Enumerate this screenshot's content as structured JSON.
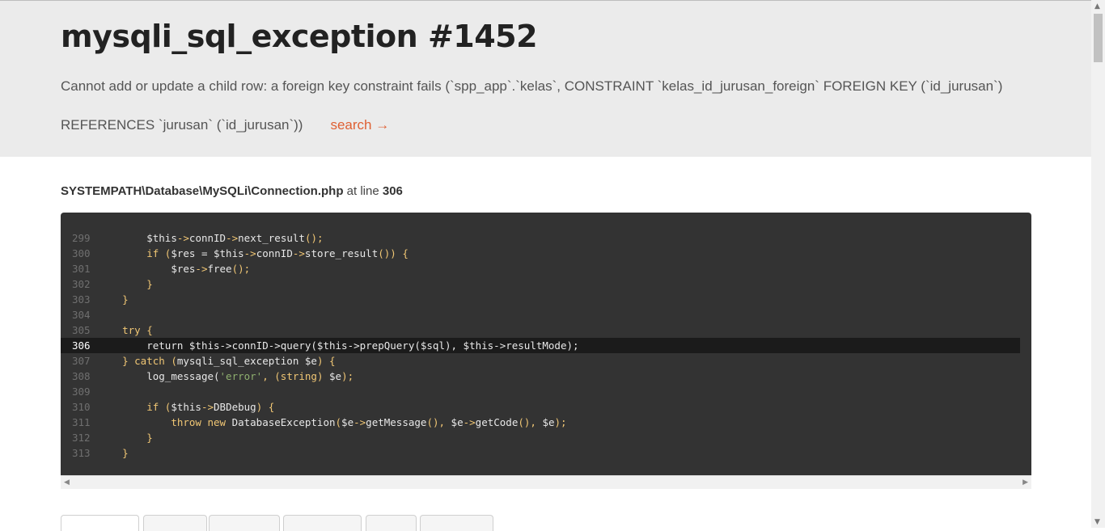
{
  "exception": {
    "title": "mysqli_sql_exception #1452",
    "message": "Cannot add or update a child row: a foreign key constraint fails (`spp_app`.`kelas`, CONSTRAINT `kelas_id_jurusan_foreign` FOREIGN KEY (`id_jurusan`) REFERENCES `jurusan` (`id_jurusan`))",
    "search_label": "search →"
  },
  "source": {
    "file": "SYSTEMPATH\\Database\\MySQLi\\Connection.php",
    "at_line_label": "at line",
    "line": "306"
  },
  "code_lines": [
    {
      "num": "299",
      "highlight": false
    },
    {
      "num": "300",
      "highlight": false
    },
    {
      "num": "301",
      "highlight": false
    },
    {
      "num": "302",
      "highlight": false
    },
    {
      "num": "303",
      "highlight": false
    },
    {
      "num": "304",
      "highlight": false
    },
    {
      "num": "305",
      "highlight": false
    },
    {
      "num": "306",
      "highlight": true
    },
    {
      "num": "307",
      "highlight": false
    },
    {
      "num": "308",
      "highlight": false
    },
    {
      "num": "309",
      "highlight": false
    },
    {
      "num": "310",
      "highlight": false
    },
    {
      "num": "311",
      "highlight": false
    },
    {
      "num": "312",
      "highlight": false
    },
    {
      "num": "313",
      "highlight": false
    }
  ],
  "code": {
    "l299": [
      "        ",
      "$this",
      "->",
      "connID",
      "->",
      "next_result",
      "();"
    ],
    "l300": [
      "        ",
      "if (",
      "$res = $this",
      "->",
      "connID",
      "->",
      "store_result",
      "()) {"
    ],
    "l301": [
      "            ",
      "$res",
      "->",
      "free",
      "();"
    ],
    "l302": [
      "        ",
      "}"
    ],
    "l303": [
      "    ",
      "}"
    ],
    "l305": [
      "    ",
      "try {"
    ],
    "l306": [
      "        ",
      "return $this->connID->query($this->prepQuery($sql), $this->resultMode);"
    ],
    "l307": [
      "    ",
      "} catch (",
      "mysqli_sql_exception $e",
      ") {"
    ],
    "l308": [
      "        ",
      "log_message(",
      "'error'",
      ", (",
      "string",
      ") ",
      "$e",
      ");"
    ],
    "l310": [
      "        ",
      "if (",
      "$this",
      "->",
      "DBDebug",
      ") {"
    ],
    "l311": [
      "            ",
      "throw new ",
      "DatabaseException",
      "(",
      "$e",
      "->",
      "getMessage",
      "(), ",
      "$e",
      "->",
      "getCode",
      "(), ",
      "$e",
      ");"
    ],
    "l312": [
      "        ",
      "}"
    ],
    "l313": [
      "    ",
      "}"
    ]
  },
  "colors": {
    "header_bg": "#ebebeb",
    "code_bg": "#333333",
    "keyword": "#f0c674",
    "string": "#8fb06f",
    "link": "#dd4814"
  }
}
